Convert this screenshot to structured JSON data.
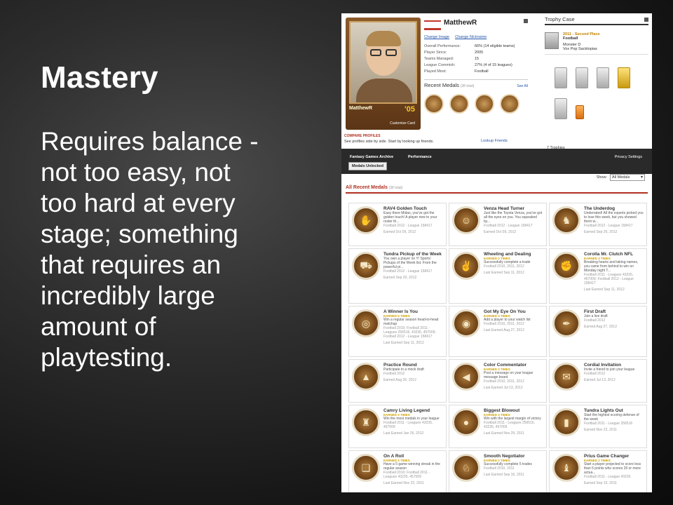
{
  "slide": {
    "title": "Mastery",
    "body": "Requires balance - not too easy, not too hard at every stage; something that requires an incredibly large amount of playtesting."
  },
  "profile": {
    "name": "MatthewR",
    "links": [
      "Change Image",
      "Change Nickname"
    ],
    "card_name": "MatthewR",
    "card_number": "'05",
    "card_sub": "Customize Card",
    "stats": [
      {
        "k": "Overall Performance:",
        "v": "66% (14 eligible teams)"
      },
      {
        "k": "Player Since:",
        "v": "2005"
      },
      {
        "k": "Teams Managed:",
        "v": "15"
      },
      {
        "k": "League Commish:",
        "v": "27% (4 of 15 leagues)"
      },
      {
        "k": "Played Most:",
        "v": "Football"
      }
    ],
    "recent_medals_title": "Recent Medals",
    "recent_medals_count": "(38 total)",
    "see_all": "See All"
  },
  "compare": {
    "heading": "COMPARE PROFILES",
    "desc": "See profiles side by side. Start by looking up friends.",
    "link": "Lookup Friends"
  },
  "trophy": {
    "title": "Trophy Case",
    "featured_title": "2011 - Second Place",
    "featured_sport": "Football",
    "featured_owner": "Monster D",
    "featured_league": "Vox Pop Sacktopias",
    "count": "7 Trophies"
  },
  "nav": {
    "archive": "Fantasy Games Archive",
    "performance": "Performance",
    "privacy": "Privacy Settings",
    "unlocked_button": "Medals Unlocked"
  },
  "filter": {
    "label": "Show:",
    "value": "All Medals"
  },
  "all_medals": {
    "title": "All Recent Medals",
    "count": "(38 total)"
  },
  "medals": [
    {
      "name": "RAV4 Golden Touch",
      "times": "",
      "desc": "Easy there Midas, you've got the golden touch! A player new to your roster th...",
      "league": "Football 2012 - League 158417",
      "date": "Earned Oct 09, 2012",
      "icon": "✋"
    },
    {
      "name": "Venza Head Turner",
      "times": "",
      "desc": "Just like the Toyota Venza, you've got all the eyes on you. You squeaked by...",
      "league": "Football 2012 - League 158417",
      "date": "Earned Oct 09, 2012",
      "icon": "☺"
    },
    {
      "name": "The Underdog",
      "times": "",
      "desc": "Underrated! All the experts picked you to lose this week, but you showed them w...",
      "league": "Football 2012 - League 158417",
      "date": "Earned Sep 26, 2012",
      "icon": "♞"
    },
    {
      "name": "Tundra Pickup of the Week",
      "times": "",
      "desc": "You own a player on Y! Sports' Pickups of the Week list. From the powerful pi...",
      "league": "Football 2012 - League 158417",
      "date": "Earned Sep 20, 2012",
      "icon": "⛟"
    },
    {
      "name": "Wheeling and Dealing",
      "times": "EARNED 3 TIMES",
      "desc": "Successfully complete a trade",
      "league": "Football 2010, 2011, 2012",
      "date": "Last Earned Sep 11, 2012",
      "icon": "✌"
    },
    {
      "name": "Corolla Mr. Clutch NFL",
      "times": "EARNED 3 TIMES",
      "desc": "Breaking hearts and taking names, you came from behind to win on Monday night T...",
      "league": "Football 2011 - Leagues 43235, 457009; Football 2012 - League 158417",
      "date": "Last Earned Sep 11, 2012",
      "icon": "✊"
    },
    {
      "name": "A Winner Is You",
      "times": "EARNED 5 TIMES",
      "desc": "Win a regular season head-to-head matchup",
      "league": "Football 2010; Football 2011 - Leagues 256516, 43235, 457009; Football 2012 - League 158417",
      "date": "Last Earned Sep 11, 2012",
      "icon": "◎"
    },
    {
      "name": "Got My Eye On You",
      "times": "EARNED 3 TIMES",
      "desc": "Add a player to your watch list",
      "league": "Football 2010, 2011, 2012",
      "date": "Last Earned Aug 27, 2012",
      "icon": "◉"
    },
    {
      "name": "First Draft",
      "times": "",
      "desc": "Join a live draft",
      "league": "Football 2012",
      "date": "Earned Aug 27, 2012",
      "icon": "✒"
    },
    {
      "name": "Practice Round",
      "times": "",
      "desc": "Participate in a mock draft",
      "league": "Football 2012",
      "date": "Earned Aug 26, 2012",
      "icon": "▲"
    },
    {
      "name": "Color Commentator",
      "times": "EARNED 3 TIMES",
      "desc": "Post a message on your league message board",
      "league": "Football 2010, 2011, 2012",
      "date": "Last Earned Jul 13, 2012",
      "icon": "◀"
    },
    {
      "name": "Cordial Invitation",
      "times": "",
      "desc": "Invite a friend to join your league",
      "league": "Football 2012",
      "date": "Earned Jul 13, 2012",
      "icon": "✉"
    },
    {
      "name": "Camry Living Legend",
      "times": "EARNED 3 TIMES",
      "desc": "Win the most medals in your league",
      "league": "Football 2011 - Leagues 43235, 457009",
      "date": "Last Earned Jan 26, 2012",
      "icon": "♜"
    },
    {
      "name": "Biggest Blowout",
      "times": "EARNED 3 TIMES",
      "desc": "Win with the largest margin of victory",
      "league": "Football 2011 - Leagues 256516, 43235, 457009",
      "date": "Last Earned Nov 29, 2011",
      "icon": "●"
    },
    {
      "name": "Tundra Lights Out",
      "times": "",
      "desc": "Start the highest scoring defense of the week",
      "league": "Football 2011 - League 256516",
      "date": "Earned Nov 22, 2011",
      "icon": "▮"
    },
    {
      "name": "On A Roll",
      "times": "EARNED 3 TIMES",
      "desc": "Have a 5 game winning streak in the regular season",
      "league": "Football 2010; Football 2011 - Leagues 43235, 457009",
      "date": "Last Earned Nov 22, 2011",
      "icon": "❏"
    },
    {
      "name": "Smooth Negotiator",
      "times": "EARNED 2 TIMES",
      "desc": "Successfully complete 5 trades",
      "league": "Football 2010, 2011",
      "date": "Last Earned Sep 16, 2011",
      "icon": "♘"
    },
    {
      "name": "Prius Game Changer",
      "times": "EARNED 2 TIMES",
      "desc": "Start a player projected to score less than 5 points who scores 20 or more actua...",
      "league": "Football 2011 - League #0235",
      "date": "Earned Sep 15, 2011",
      "icon": "♝"
    }
  ]
}
